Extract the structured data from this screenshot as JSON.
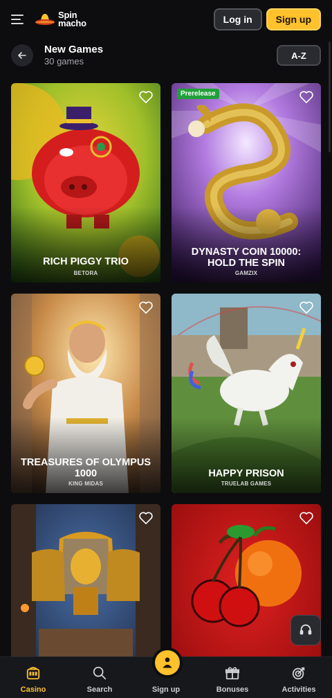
{
  "header": {
    "logo_line1": "Spin",
    "logo_line2": "macho",
    "login_label": "Log in",
    "signup_label": "Sign up"
  },
  "subheader": {
    "title": "New Games",
    "count": "30 games",
    "sort_label": "A-Z"
  },
  "games": [
    {
      "title": "RICH PIGGY TRIO",
      "provider": "BETORA",
      "badge": ""
    },
    {
      "title": "DYNASTY COIN 10000: HOLD THE SPIN",
      "provider": "GAMZIX",
      "badge": "Prerelease"
    },
    {
      "title": "TREASURES OF OLYMPUS 1000",
      "provider": "KING MIDAS",
      "badge": ""
    },
    {
      "title": "HAPPY PRISON",
      "provider": "TRUELAB GAMES",
      "badge": ""
    },
    {
      "title": "",
      "provider": "",
      "badge": ""
    },
    {
      "title": "",
      "provider": "",
      "badge": ""
    }
  ],
  "nav": [
    {
      "label": "Casino",
      "icon": "slot-machine-icon",
      "active": true
    },
    {
      "label": "Search",
      "icon": "search-icon",
      "active": false
    },
    {
      "label": "Sign up",
      "icon": "user-plus-icon",
      "active": false
    },
    {
      "label": "Bonuses",
      "icon": "gift-icon",
      "active": false
    },
    {
      "label": "Activities",
      "icon": "target-icon",
      "active": false
    }
  ],
  "colors": {
    "accent": "#ffc12c",
    "background": "#0d0d0f",
    "prerelease_badge": "#21a03a"
  }
}
